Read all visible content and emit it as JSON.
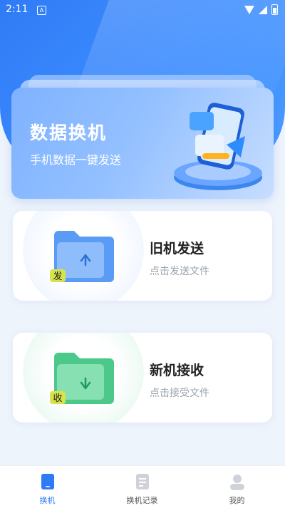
{
  "status_bar": {
    "time": "2:11",
    "notification_glyph": "A"
  },
  "banner": {
    "title": "数据换机",
    "subtitle": "手机数据一键发送"
  },
  "cards": {
    "old": {
      "title": "旧机发送",
      "subtitle": "点击发送文件",
      "badge": "发",
      "arrow_icon": "arrow-up-icon"
    },
    "new": {
      "title": "新机接收",
      "subtitle": "点击接受文件",
      "badge": "收",
      "arrow_icon": "arrow-down-icon"
    }
  },
  "nav": {
    "items": [
      {
        "label": "换机",
        "icon": "phone-icon",
        "active": true
      },
      {
        "label": "换机记录",
        "icon": "record-icon",
        "active": false
      },
      {
        "label": "我的",
        "icon": "user-icon",
        "active": false
      }
    ]
  },
  "colors": {
    "primary": "#2f7bf5",
    "active_nav": "#2f7bf5",
    "inactive_nav": "#555555",
    "old_folder": "#5a9cf5",
    "new_folder": "#4cc98a",
    "badge": "#d7e34a"
  }
}
